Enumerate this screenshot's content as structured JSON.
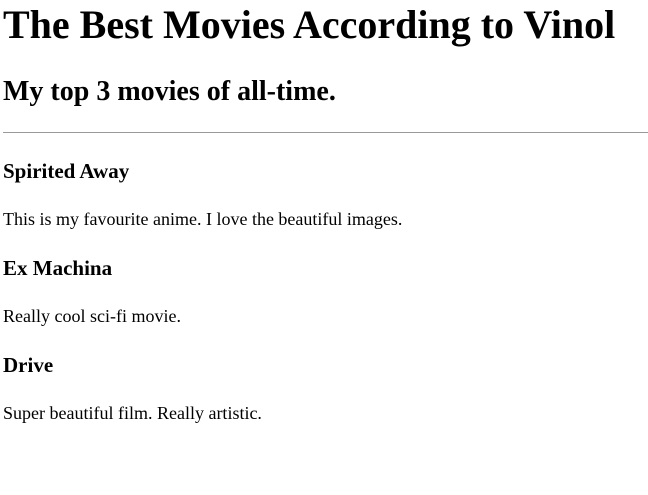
{
  "header": {
    "title": "The Best Movies According to Vinol",
    "subtitle": "My top 3 movies of all-time."
  },
  "movies": [
    {
      "title": "Spirited Away",
      "description": "This is my favourite anime. I love the beautiful images."
    },
    {
      "title": "Ex Machina",
      "description": "Really cool sci-fi movie."
    },
    {
      "title": "Drive",
      "description": "Super beautiful film. Really artistic."
    }
  ]
}
